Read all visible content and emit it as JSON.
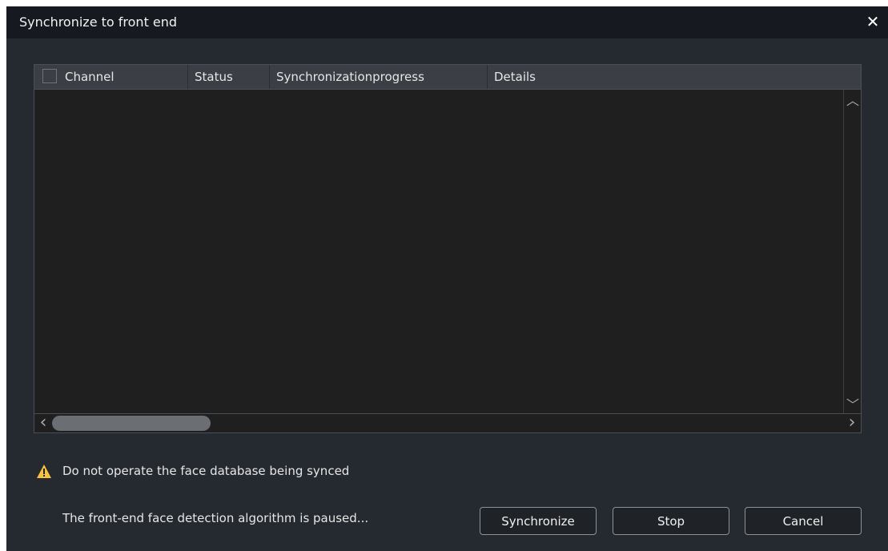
{
  "dialog": {
    "title": "Synchronize to front end",
    "close_icon": "close-icon",
    "close_glyph": "✕"
  },
  "table": {
    "columns": [
      {
        "key": "channel",
        "label": "Channel"
      },
      {
        "key": "status",
        "label": "Status"
      },
      {
        "key": "progress",
        "label": "Synchronizationprogress"
      },
      {
        "key": "details",
        "label": "Details"
      }
    ],
    "rows": [],
    "select_all_checked": false
  },
  "scrollbars": {
    "up_arrow": "︿",
    "down_arrow": "﹀",
    "left_arrow": "‹",
    "right_arrow": "›"
  },
  "warning": {
    "icon": "warning-icon",
    "text": "Do not operate the face database being synced",
    "color": "#f5c242"
  },
  "status_text": "The front-end face detection algorithm is paused...",
  "buttons": {
    "synchronize": "Synchronize",
    "stop": "Stop",
    "cancel": "Cancel"
  }
}
